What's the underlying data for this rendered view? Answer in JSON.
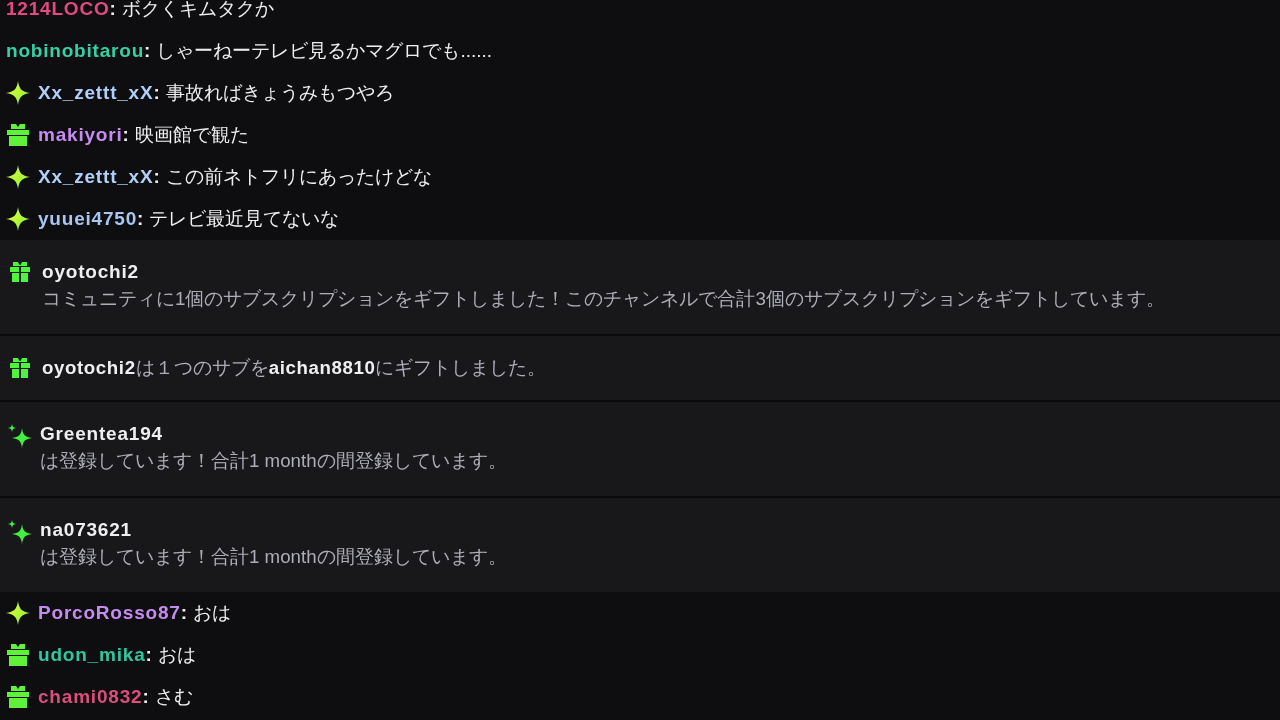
{
  "feed": [
    {
      "kind": "chat",
      "user": "1214LOCO",
      "color": "#e2497c",
      "separator": ":",
      "message": "ボクくキムタクか"
    },
    {
      "kind": "chat",
      "user": "nobinobitarou",
      "color": "#33d1a6",
      "separator": ":",
      "message": "しゃーねーテレビ見るかマグロでも......"
    },
    {
      "kind": "sub_chat",
      "user": "Xx_zettt_xX",
      "color": "#b2cffb",
      "separator": ":",
      "message": "事故ればきょうみもつやろ"
    },
    {
      "kind": "gifter_chat",
      "user": "makiyori",
      "color": "#c68cf2",
      "separator": ":",
      "message": "映画館で観た"
    },
    {
      "kind": "sub_chat",
      "user": "Xx_zettt_xX",
      "color": "#b2cffb",
      "separator": ":",
      "message": "この前ネトフリにあったけどな"
    },
    {
      "kind": "sub_chat",
      "user": "yuuei4750",
      "color": "#a8c6f0",
      "separator": ":",
      "message": "テレビ最近見てないな"
    },
    {
      "kind": "gift_summary",
      "title": "oyotochi2",
      "message": "コミュニティに1個のサブスクリプションをギフトしました！このチャンネルで合計3個のサブスクリプションをギフトしています。"
    },
    {
      "kind": "gift_single",
      "text": "**oyotochi2**は１つのサブを**aichan8810**にギフトしました。"
    },
    {
      "kind": "sub_notice",
      "title": "Greentea194",
      "message": "は登録しています！合計1 monthの間登録しています。"
    },
    {
      "kind": "sub_notice",
      "title": "na073621",
      "message": "は登録しています！合計1 monthの間登録しています。"
    },
    {
      "kind": "sub_chat",
      "user": "PorcoRosso87",
      "color": "#c48cf0",
      "separator": ":",
      "message": "おは"
    },
    {
      "kind": "gifter_chat",
      "user": "udon_mika",
      "color": "#2fc7a1",
      "separator": ":",
      "message": "おは"
    },
    {
      "kind": "gifter_chat",
      "user": "chami0832",
      "color": "#d94f7c",
      "separator": ":",
      "message": "さむ"
    }
  ]
}
